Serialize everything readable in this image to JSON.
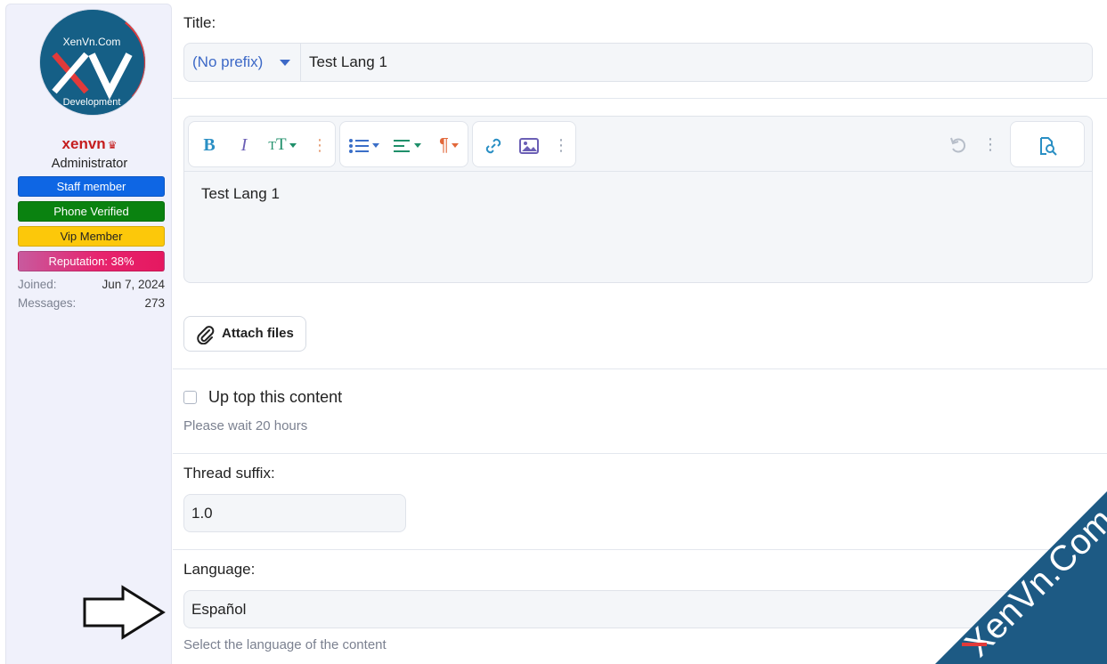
{
  "sidebar": {
    "avatar": {
      "top_text": "XenVn.Com",
      "mark": "XV",
      "bottom_text": "Development"
    },
    "username": "xenvn",
    "role": "Administrator",
    "badges": [
      "Staff member",
      "Phone Verified",
      "Vip Member",
      "Reputation: 38%"
    ],
    "stats": [
      {
        "label": "Joined:",
        "value": "Jun 7, 2024"
      },
      {
        "label": "Messages:",
        "value": "273"
      }
    ]
  },
  "form": {
    "title_label": "Title:",
    "prefix": "(No prefix)",
    "title_value": "Test Lang 1",
    "editor_text": "Test Lang 1",
    "attach_label": "Attach files",
    "uptop_label": "Up top this content",
    "uptop_hint": "Please wait 20 hours",
    "suffix_label": "Thread suffix:",
    "suffix_value": "1.0",
    "language_label": "Language:",
    "language_value": "Español",
    "language_hint": "Select the language of the content"
  },
  "toolbar": {
    "icons": [
      "bold-icon",
      "italic-icon",
      "text-size-icon",
      "more-vertical-icon",
      "list-icon",
      "align-icon",
      "paragraph-icon",
      "link-icon",
      "image-icon",
      "more-vertical-icon",
      "undo-icon",
      "more-vertical-icon",
      "preview-icon"
    ]
  },
  "watermark": {
    "text": "XenVn.Com"
  },
  "colors": {
    "accent": "#3d69c7",
    "username": "#c51e1e",
    "staff_badge": "#0e66e4",
    "phone_badge": "#0a8210",
    "vip_badge": "#fcc80a",
    "rep_badge": "#e7246e",
    "watermark": "#1d5a84"
  }
}
